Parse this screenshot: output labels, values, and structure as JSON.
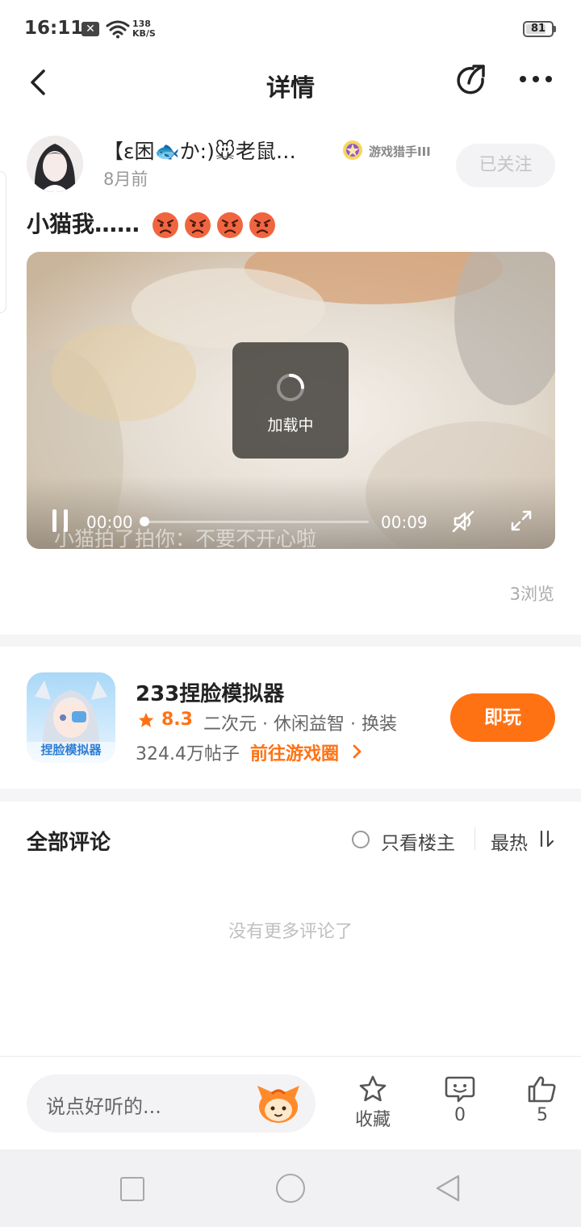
{
  "status_bar": {
    "time": "16:11",
    "network_speed_value": "138",
    "network_speed_unit": "KB/S",
    "battery_level": "81"
  },
  "header": {
    "title": "详情"
  },
  "post": {
    "author_name": "【ε困🐟か:)🐭老鼠…",
    "time": "8月前",
    "badge_label": "游戏猎手III",
    "follow_label": "已关注",
    "title": "小猫我……",
    "emoji_count": 4,
    "views": "3浏览"
  },
  "video": {
    "loading_text": "加载中",
    "subtitle": "小猫拍了拍你：不要不开心啦",
    "current_time": "00:00",
    "total_time": "00:09",
    "progress": 0
  },
  "game": {
    "name": "233捏脸模拟器",
    "rating": "8.3",
    "tags": "二次元 · 休闲益智 · 换装",
    "posts": "324.4万帖子",
    "goto_label": "前往游戏圈",
    "play_label": "即玩",
    "icon_text": "捏脸模拟器"
  },
  "comments": {
    "title": "全部评论",
    "only_op_label": "只看楼主",
    "sort_label": "最热",
    "empty_text": "没有更多评论了"
  },
  "bottom_bar": {
    "input_placeholder": "说点好听的...",
    "favorite_label": "收藏",
    "comment_count": "0",
    "like_count": "5"
  },
  "colors": {
    "accent": "#ff7214",
    "muted": "#c0c0c0"
  }
}
